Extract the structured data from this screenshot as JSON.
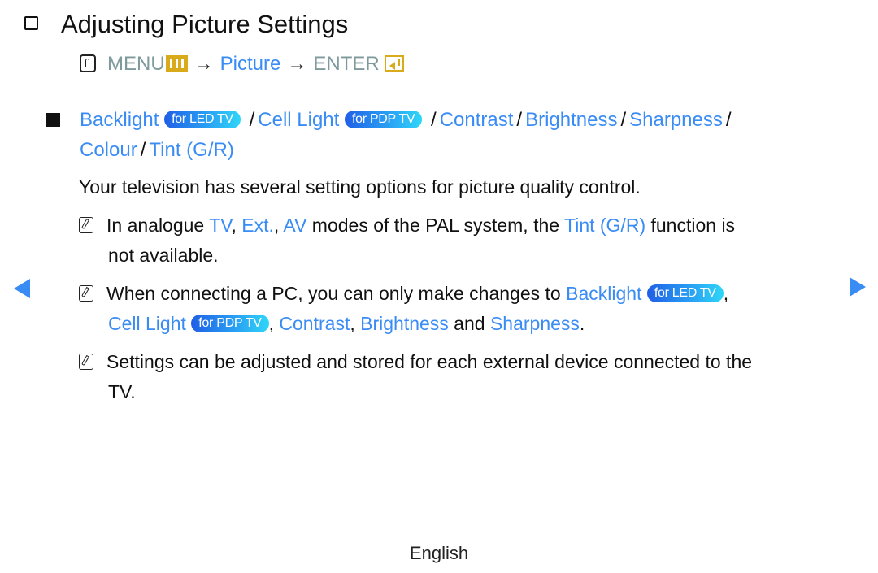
{
  "title": "Adjusting Picture Settings",
  "menu_path": {
    "menu": "MENU",
    "arrow": "→",
    "picture": "Picture",
    "enter": "ENTER"
  },
  "section": {
    "items": [
      {
        "label": "Backlight",
        "badge": "for LED TV"
      },
      {
        "label": "Cell Light",
        "badge": "for PDP TV"
      },
      {
        "label": "Contrast"
      },
      {
        "label": "Brightness"
      },
      {
        "label": "Sharpness"
      },
      {
        "label": "Colour"
      },
      {
        "label": "Tint (G/R)"
      }
    ],
    "separator": "/"
  },
  "description": "Your television has several setting options for picture quality control.",
  "notes": [
    {
      "parts": [
        "In analogue ",
        "TV",
        ", ",
        "Ext.",
        ", ",
        "AV",
        " modes of the PAL system, the ",
        "Tint (G/R)",
        " function is"
      ],
      "continuation": "not available."
    },
    {
      "parts": [
        "When connecting a PC, you can only make changes to ",
        "Backlight",
        "for LED TV",
        ","
      ],
      "continuation_parts": [
        "Cell Light",
        "for PDP TV",
        ", ",
        "Contrast",
        ", ",
        "Brightness",
        " and ",
        "Sharpness",
        "."
      ]
    },
    {
      "text": "Settings can be adjusted and stored for each external device connected to the",
      "continuation": "TV."
    }
  ],
  "nav": {
    "prev": "previous-page",
    "next": "next-page"
  },
  "footer": "English",
  "colors": {
    "link": "#3a8cf5",
    "menu_grey": "#7f9a9c",
    "accent_yellow": "#d9aa1a"
  }
}
